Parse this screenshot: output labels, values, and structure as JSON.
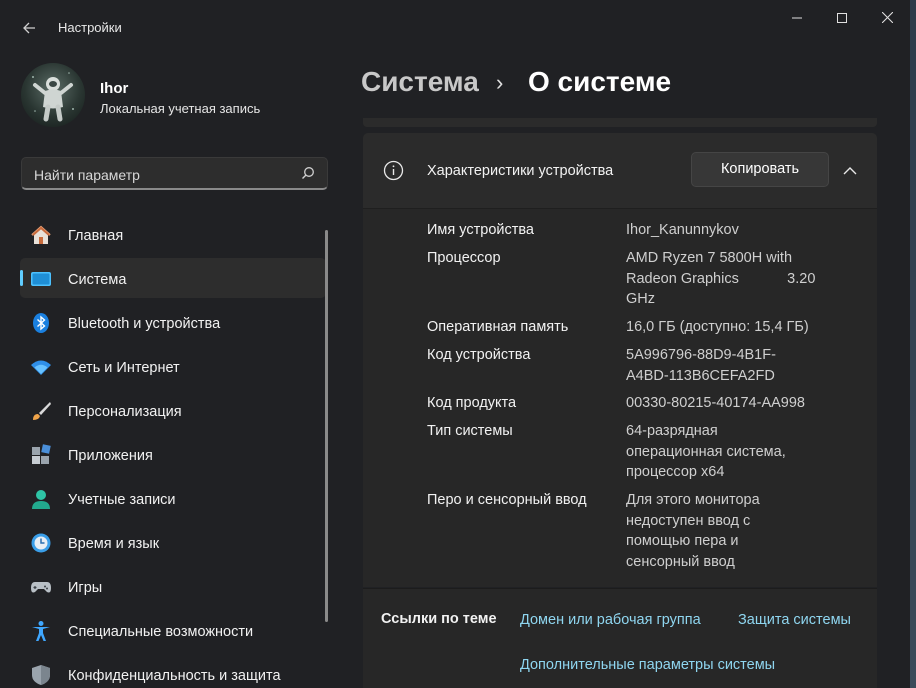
{
  "window": {
    "title": "Настройки",
    "back_icon": "back-arrow-icon",
    "controls": [
      "minimize-icon",
      "maximize-icon",
      "close-icon"
    ]
  },
  "profile": {
    "name": "Ihor",
    "account_type": "Локальная учетная запись"
  },
  "search": {
    "placeholder": "Найти параметр"
  },
  "sidebar": {
    "items": [
      {
        "label": "Главная",
        "icon": "home-icon",
        "active": false
      },
      {
        "label": "Система",
        "icon": "system-display-icon",
        "active": true
      },
      {
        "label": "Bluetooth и устройства",
        "icon": "bluetooth-icon",
        "active": false
      },
      {
        "label": "Сеть и Интернет",
        "icon": "wifi-icon",
        "active": false
      },
      {
        "label": "Персонализация",
        "icon": "brush-icon",
        "active": false
      },
      {
        "label": "Приложения",
        "icon": "apps-icon",
        "active": false
      },
      {
        "label": "Учетные записи",
        "icon": "account-icon",
        "active": false
      },
      {
        "label": "Время и язык",
        "icon": "globe-clock-icon",
        "active": false
      },
      {
        "label": "Игры",
        "icon": "gamepad-icon",
        "active": false
      },
      {
        "label": "Специальные возможности",
        "icon": "accessibility-icon",
        "active": false
      },
      {
        "label": "Конфиденциальность и защита",
        "icon": "shield-icon",
        "active": false
      }
    ]
  },
  "header": {
    "parent": "Система",
    "separator": "›",
    "current": "О системе"
  },
  "device_specs": {
    "title": "Характеристики устройства",
    "copy_label": "Копировать",
    "rows": [
      {
        "label": "Имя устройства",
        "value_lines": [
          "Ihor_Kanunnykov"
        ]
      },
      {
        "label": "Процессор",
        "value_lines": [
          "AMD Ryzen 7 5800H with",
          "Radeon Graphics            3.20",
          "GHz"
        ]
      },
      {
        "label": "Оперативная память",
        "value_lines": [
          "16,0 ГБ (доступно: 15,4 ГБ)"
        ]
      },
      {
        "label": "Код устройства",
        "value_lines": [
          "5A996796-88D9-4B1F-",
          "A4BD-113B6CEFA2FD"
        ]
      },
      {
        "label": "Код продукта",
        "value_lines": [
          "00330-80215-40174-AA998"
        ]
      },
      {
        "label": "Тип системы",
        "value_lines": [
          "64-разрядная",
          "операционная система,",
          "процессор x64"
        ]
      },
      {
        "label": "Перо и сенсорный ввод",
        "value_lines": [
          "Для этого монитора",
          "недоступен ввод с",
          "помощью пера и",
          "сенсорный ввод"
        ]
      }
    ]
  },
  "related": {
    "title": "Ссылки по теме",
    "links": [
      "Домен или рабочая группа",
      "Защита системы",
      "Дополнительные параметры системы"
    ]
  },
  "colors": {
    "accent": "#60cdff",
    "link": "#8fd6f0",
    "window_bg": "#202124",
    "card_bg": "#2b2b2b"
  }
}
